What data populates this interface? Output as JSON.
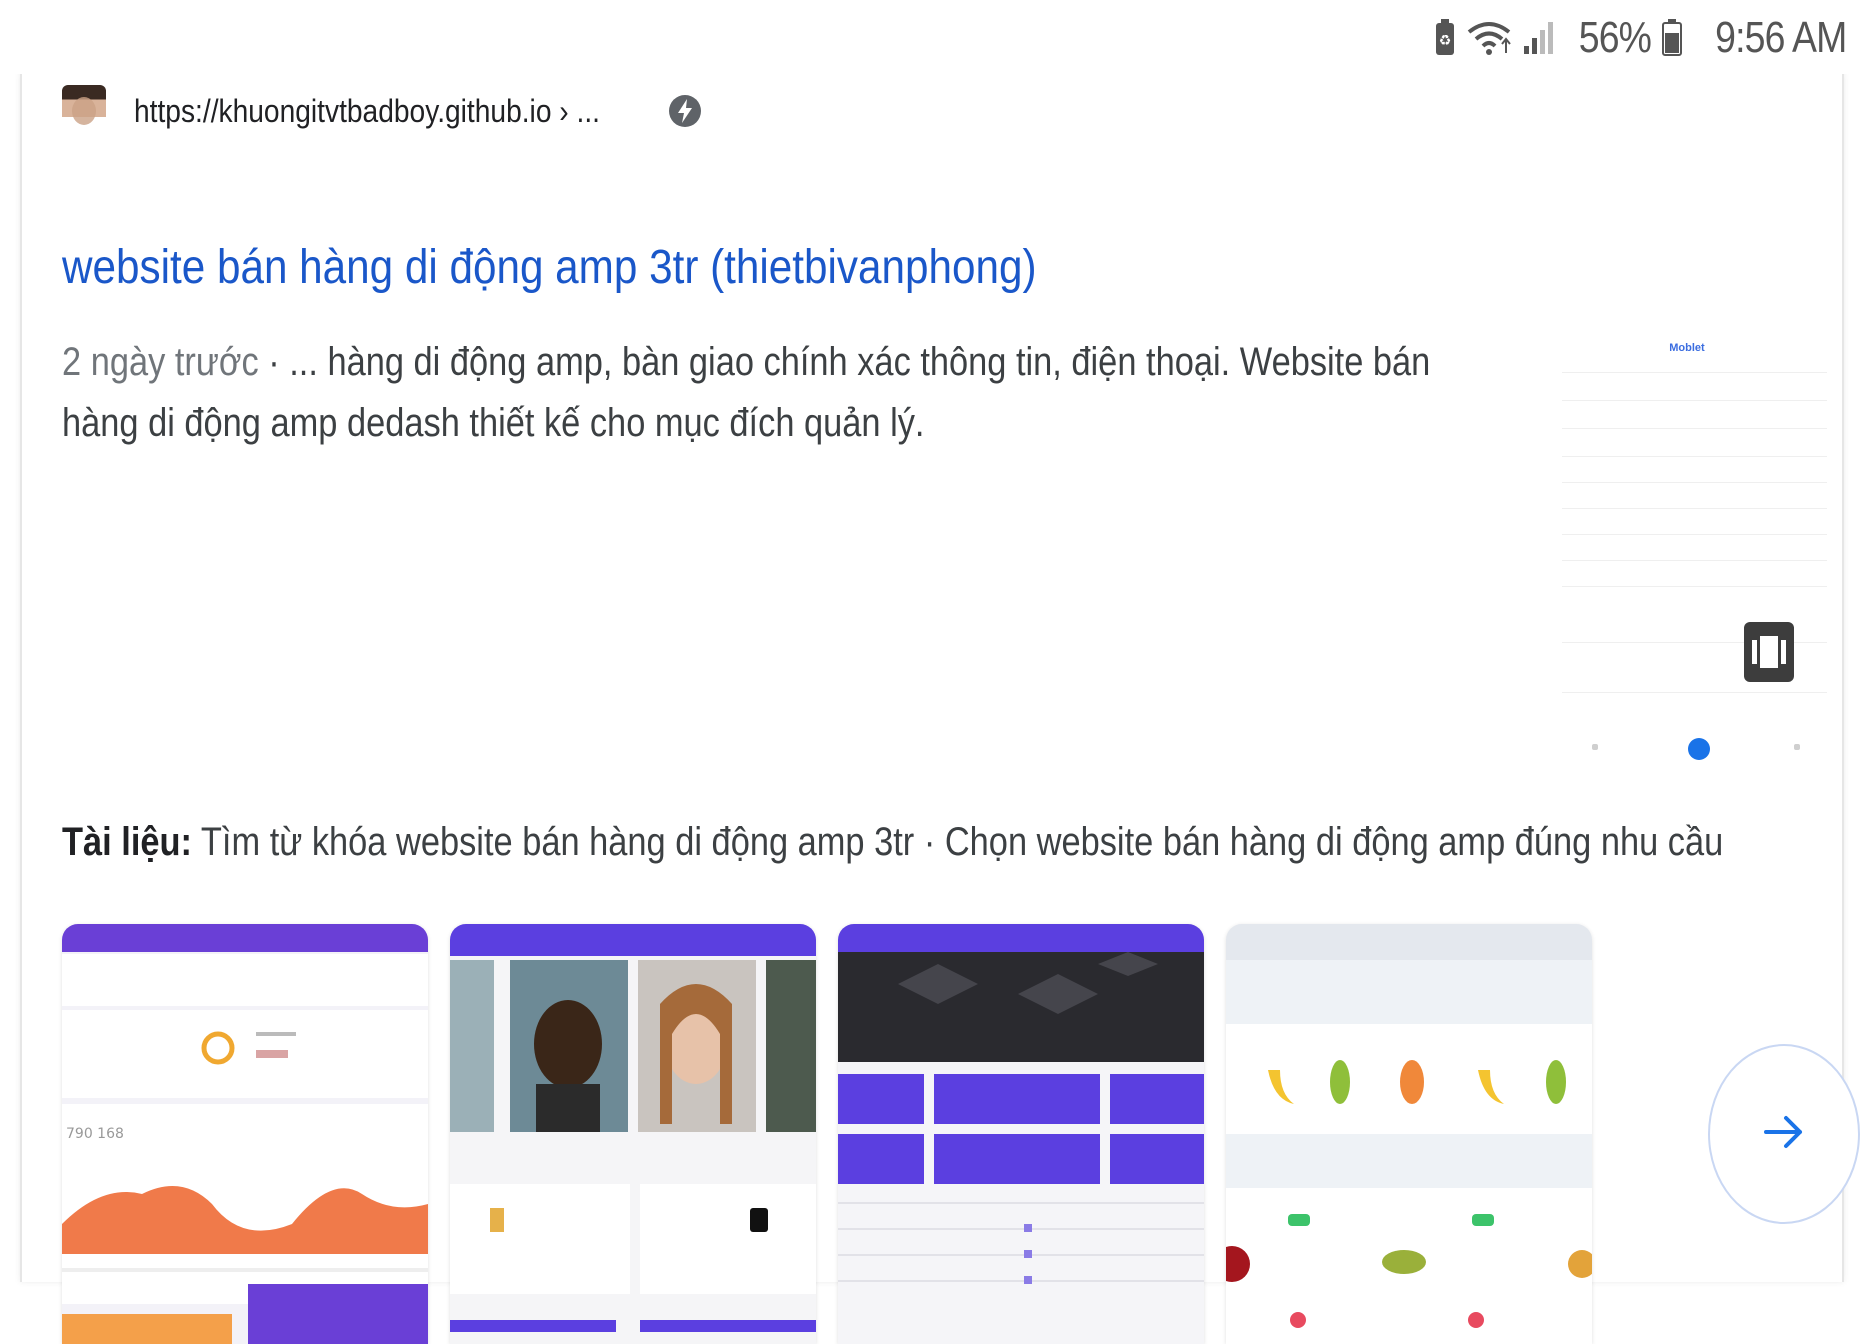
{
  "status_bar": {
    "battery_percent": "56%",
    "time": "9:56 AM",
    "icons": [
      "battery-saver-icon",
      "wifi-icon",
      "signal-icon",
      "battery-icon"
    ]
  },
  "result": {
    "source_url": "https://khuongitvtbadboy.github.io › ...",
    "favicon": "avatar-photo",
    "amp_icon": "amp-lightning-icon",
    "title": "website bán hàng di động amp 3tr (thietbivanphong)",
    "snippet_date": "2 ngày trước",
    "snippet_text": " · ... hàng di động amp, bàn giao chính xác thông tin, điện thoại. Website bán hàng di động amp dedash thiết kế cho mục đích quản lý.",
    "thumbnail_caption": "Moblet",
    "doc_label": "Tài liệu:",
    "doc_text": " Tìm từ khóa website bán hàng di động amp 3tr · Chọn website bán hàng di động amp đúng nhu cầu"
  },
  "carousel": {
    "images": [
      "dashboard-chart-screenshot",
      "profile-gallery-screenshot",
      "app-menu-screenshot",
      "fruit-shop-screenshot"
    ],
    "next_icon": "arrow-right-icon"
  },
  "colors": {
    "link": "#1a57c9",
    "accent_purple": "#5b3fe0",
    "chart_orange": "#f07a4a"
  }
}
